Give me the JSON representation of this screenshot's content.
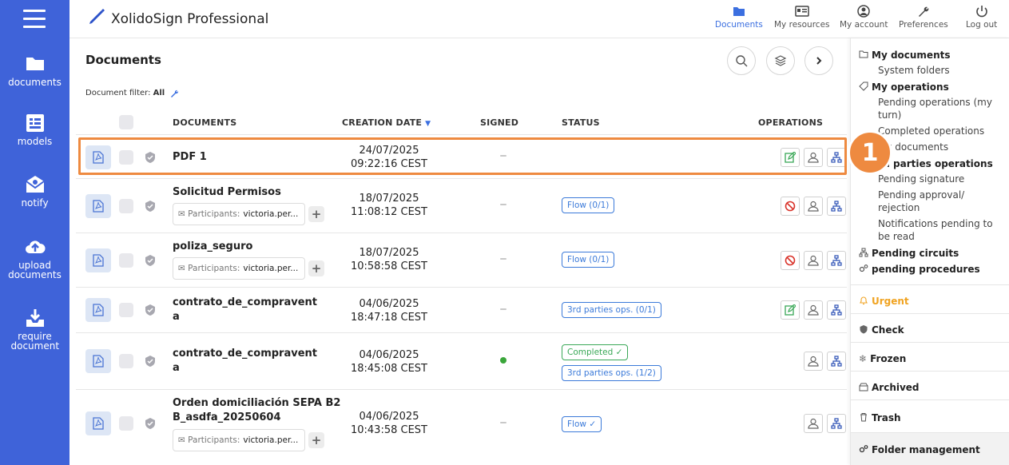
{
  "sidebar": {
    "items": [
      {
        "label": "documents",
        "icon": "folder-icon"
      },
      {
        "label": "models",
        "icon": "models-icon"
      },
      {
        "label": "notify",
        "icon": "notify-icon"
      },
      {
        "label": "upload documents",
        "icon": "upload-cloud-icon"
      },
      {
        "label": "require document",
        "icon": "require-download-icon"
      }
    ]
  },
  "header": {
    "app_title": "XolidoSign Professional",
    "nav": [
      {
        "label": "Documents",
        "icon": "folder-icon",
        "active": true
      },
      {
        "label": "My resources",
        "icon": "id-card-icon"
      },
      {
        "label": "My account",
        "icon": "user-icon"
      },
      {
        "label": "Preferences",
        "icon": "wrench-icon"
      },
      {
        "label": "Log out",
        "icon": "power-icon"
      }
    ]
  },
  "main": {
    "title": "Documents",
    "filter_prefix": "Document filter:",
    "filter_value": "All",
    "columns": [
      "DOCUMENTS",
      "CREATION DATE",
      "SIGNED",
      "STATUS",
      "OPERATIONS"
    ],
    "participants_label": "Participants:",
    "rows": [
      {
        "name": "PDF 1",
        "date": "24/07/2025",
        "time": "09:22:16 CEST",
        "signed": false,
        "statuses": [],
        "participants": null,
        "ops": [
          "edit",
          "user",
          "tree"
        ]
      },
      {
        "name": "Solicitud Permisos",
        "date": "18/07/2025",
        "time": "11:08:12 CEST",
        "signed": false,
        "statuses": [
          "Flow (0/1)"
        ],
        "participants": "victoria.per...",
        "ops": [
          "block",
          "user",
          "tree"
        ]
      },
      {
        "name": "poliza_seguro",
        "date": "18/07/2025",
        "time": "10:58:58 CEST",
        "signed": false,
        "statuses": [
          "Flow (0/1)"
        ],
        "participants": "victoria.per...",
        "ops": [
          "block",
          "user",
          "tree"
        ]
      },
      {
        "name_line1": "contrato_de_compravent",
        "name_line2": "a",
        "date": "04/06/2025",
        "time": "18:47:18 CEST",
        "signed": false,
        "statuses": [
          "3rd parties ops. (0/1)"
        ],
        "participants": null,
        "ops": [
          "edit",
          "user",
          "tree"
        ]
      },
      {
        "name_line1": "contrato_de_compravent",
        "name_line2": "a",
        "date": "04/06/2025",
        "time": "18:45:08 CEST",
        "signed": true,
        "statuses": [
          "Completed",
          "3rd parties ops. (1/2)"
        ],
        "participants": null,
        "ops": [
          "user",
          "tree"
        ]
      },
      {
        "name_line1": "Orden domiciliación SEPA B2",
        "name_line2": "B_asdfa_20250604",
        "date": "04/06/2025",
        "time": "10:43:58 CEST",
        "signed": false,
        "statuses": [
          "Flow"
        ],
        "participants": "victoria.per...",
        "ops": [
          "user",
          "tree"
        ]
      }
    ]
  },
  "annotation": {
    "number": "1"
  },
  "right_panel": {
    "my_documents": "My documents",
    "system_folders": "System folders",
    "my_operations": "My operations",
    "pending_operations": "Pending operations (my turn)",
    "completed_operations": "Completed operations",
    "my_documents_sub": "My documents",
    "third_parties": "3rd parties operations",
    "pending_signature": "Pending signature",
    "pending_approval": "Pending approval/ rejection",
    "notifications_pending": "Notifications pending to be read",
    "pending_circuits": "Pending circuits",
    "pending_procedures": "pending procedures",
    "urgent": "Urgent",
    "check": "Check",
    "frozen": "Frozen",
    "archived": "Archived",
    "trash": "Trash",
    "folder_management": "Folder management"
  },
  "colors": {
    "sidebar": "#3f63d9",
    "accent": "#3b6fe0",
    "highlight": "#ee8a40",
    "urgent": "#f0a321",
    "completed": "#3aa857"
  }
}
